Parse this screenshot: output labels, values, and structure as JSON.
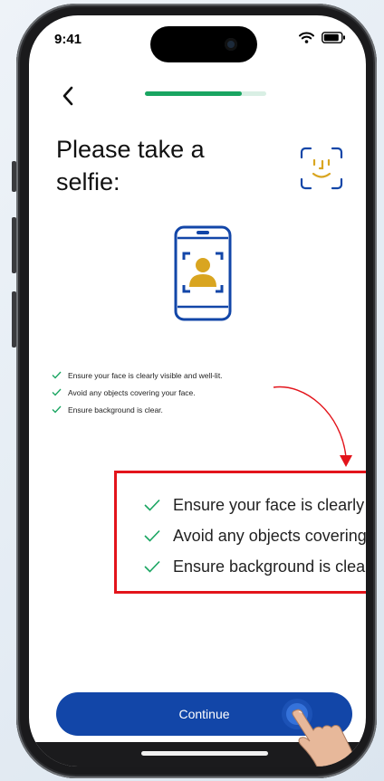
{
  "status_bar": {
    "time": "9:41",
    "icons": [
      "wifi-icon",
      "battery-icon"
    ]
  },
  "header": {
    "back_icon": "chevron-left-icon",
    "progress": 0.8,
    "progress_color": "#19a561"
  },
  "main": {
    "title": "Please take a selfie:",
    "face_id_icon": "face-id-icon",
    "illustration": "selfie-phone-illustration",
    "accent_color": "#1246a8",
    "gold_color": "#d9a520"
  },
  "checklist": [
    {
      "text": "Ensure your face is clearly visible and well-lit."
    },
    {
      "text": "Avoid any objects covering your face."
    },
    {
      "text": "Ensure background is clear."
    }
  ],
  "zoom_callout": {
    "border_color": "#e3141b",
    "items": [
      {
        "text": "Ensure your face is clearly visible and well-lit."
      },
      {
        "text": "Avoid any objects covering your face."
      },
      {
        "text": "Ensure background is clear."
      }
    ]
  },
  "footer": {
    "continue_label": "Continue",
    "button_color": "#1246a8"
  }
}
